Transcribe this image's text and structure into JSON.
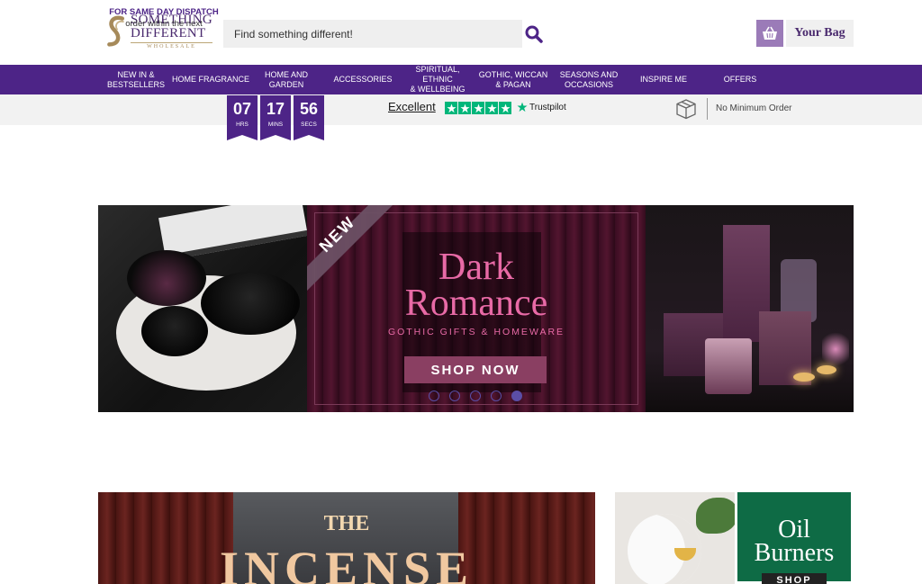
{
  "header": {
    "logo": {
      "line1": "SOMETHING",
      "line2": "DIFFERENT",
      "line3": "WHOLESALE"
    },
    "search": {
      "placeholder": "Find something different!"
    },
    "bag_label": "Your Bag"
  },
  "nav": {
    "items": [
      {
        "label": "NEW IN &\nBESTSELLERS"
      },
      {
        "label": "HOME FRAGRANCE"
      },
      {
        "label": "HOME AND\nGARDEN"
      },
      {
        "label": "ACCESSORIES"
      },
      {
        "label": "SPIRITUAL, ETHNIC\n& WELLBEING"
      },
      {
        "label": "GOTHIC, WICCAN\n& PAGAN"
      },
      {
        "label": "SEASONS AND\nOCCASIONS"
      },
      {
        "label": "INSPIRE ME"
      },
      {
        "label": "OFFERS"
      }
    ]
  },
  "infobar": {
    "dispatch_title": "FOR SAME DAY DISPATCH",
    "dispatch_sub": "order within the next",
    "timer": [
      {
        "value": "07",
        "unit": "HRS"
      },
      {
        "value": "17",
        "unit": "MINS"
      },
      {
        "value": "56",
        "unit": "SECS"
      }
    ],
    "trustpilot": {
      "rating_text": "Excellent",
      "brand": "Trustpilot",
      "stars": 5
    },
    "min_order": "No Minimum Order"
  },
  "hero": {
    "ribbon": "NEW",
    "title_line1": "Dark",
    "title_line2": "Romance",
    "subtitle": "GOTHIC GIFTS & HOMEWARE",
    "cta": "SHOP NOW",
    "slides": 5,
    "active_slide": 5
  },
  "banners": {
    "incense": {
      "line1": "THE",
      "line2": "INCENSE"
    },
    "oil": {
      "line1": "Oil",
      "line2": "Burners",
      "cta": "SHOP"
    }
  },
  "colors": {
    "brand_purple": "#4d2487",
    "trustpilot_green": "#00b67a",
    "hero_pink": "#e86aa6"
  }
}
